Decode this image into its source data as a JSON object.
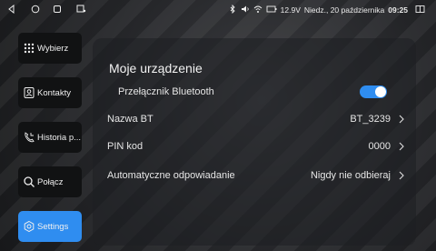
{
  "status": {
    "icons": [
      "back-icon",
      "home-icon",
      "recents-icon",
      "app-icon",
      "bluetooth-icon",
      "volume-icon",
      "wifi-icon",
      "battery-icon",
      "screen-icon"
    ],
    "voltage": "12.9V",
    "date": "Niedz., 20 października",
    "time": "09:25"
  },
  "sidebar": {
    "items": [
      {
        "label": "Wybierz",
        "icon": "dialpad-icon"
      },
      {
        "label": "Kontakty",
        "icon": "contacts-icon"
      },
      {
        "label": "Historia p...",
        "icon": "call-history-icon"
      },
      {
        "label": "Połącz",
        "icon": "search-icon"
      },
      {
        "label": "Settings",
        "icon": "settings-icon"
      }
    ],
    "active": "Settings"
  },
  "main": {
    "title": "Moje urządzenie",
    "bluetooth_switch": {
      "label": "Przełącznik Bluetooth",
      "on": true
    },
    "bt_name": {
      "label": "Nazwa BT",
      "value": "BT_3239"
    },
    "pin": {
      "label": "PIN kod",
      "value": "0000"
    },
    "auto_answer": {
      "label": "Automatyczne odpowiadanie",
      "value": "Nigdy nie odbieraj"
    }
  },
  "colors": {
    "accent": "#2f8df0",
    "button_bg": "#111213"
  }
}
